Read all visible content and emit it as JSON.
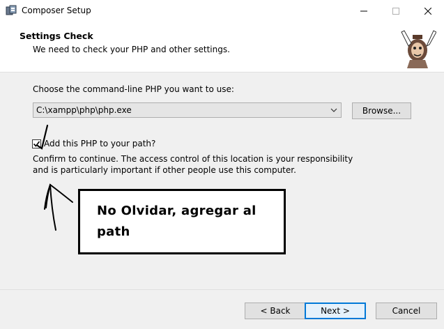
{
  "window": {
    "title": "Composer Setup",
    "minimize_glyph": "—",
    "maximize_glyph": "☐",
    "close_glyph": "✕"
  },
  "header": {
    "title": "Settings Check",
    "subtitle": "We need to check your PHP and other settings."
  },
  "main": {
    "choose_label": "Choose the command-line PHP you want to use:",
    "php_select": {
      "value": "C:\\xampp\\php\\php.exe"
    },
    "browse_label": "Browse...",
    "add_to_path": {
      "label": "Add this PHP to your path?",
      "checked": true
    },
    "confirm_text": "Confirm to continue. The access control of this location is your responsibility and is particularly important if other people use this computer."
  },
  "annotation": {
    "text": "No Olvidar, agregar al path"
  },
  "footer": {
    "back_label": "< Back",
    "next_label": "Next >",
    "cancel_label": "Cancel"
  },
  "colors": {
    "content_bg": "#f0f0f0",
    "accent": "#0078d7"
  },
  "icons": [
    "composer-app-icon",
    "composer-logo-icon",
    "chevron-down-icon",
    "checkmark-icon"
  ]
}
